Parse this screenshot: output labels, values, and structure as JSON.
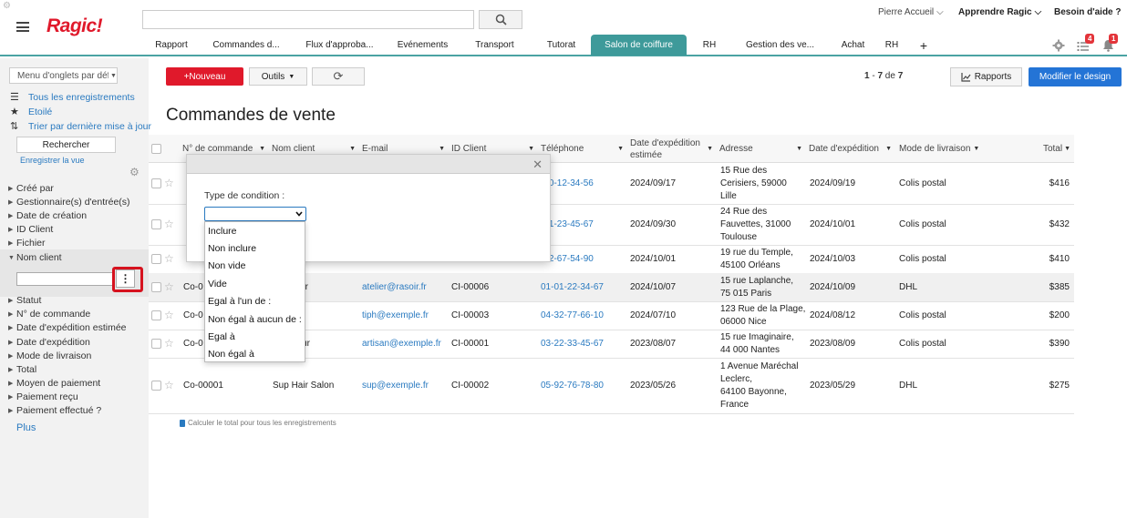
{
  "app": {
    "logo": "Ragic!",
    "search_placeholder": ""
  },
  "top_links": {
    "user": "Pierre Accueil",
    "learn": "Apprendre Ragic",
    "help": "Besoin d'aide ?"
  },
  "tabs": [
    "Rapport",
    "Commandes d...",
    "Flux d'approba...",
    "Evénements",
    "Transport",
    "Tutorat",
    "Salon de coiffure",
    "RH",
    "Gestion des ve...",
    "Achat",
    "RH",
    "+"
  ],
  "badges": {
    "tasks": "4",
    "notifications": "1"
  },
  "sidebar": {
    "tab_menu": "Menu d'onglets par défaut",
    "links": [
      "Tous les enregistrements",
      "Etoilé",
      "Trier par dernière mise à jour"
    ],
    "search_button": "Rechercher",
    "save_view": "Enregistrer la vue",
    "facets_top": [
      "Créé par",
      "Gestionnaire(s) d'entrée(s)",
      "Date de création",
      "ID Client",
      "Fichier"
    ],
    "facet_open": "Nom client",
    "facets_bottom": [
      "Statut",
      "N° de commande",
      "Date d'expédition estimée",
      "Date d'expédition",
      "Mode de livraison",
      "Total",
      "Moyen de paiement",
      "Paiement reçu",
      "Paiement effectué ?"
    ],
    "more": "Plus"
  },
  "toolbar": {
    "new": "+Nouveau",
    "tools": "Outils",
    "reports": "Rapports",
    "design": "Modifier le design"
  },
  "pager": {
    "start": "1",
    "sep": " - ",
    "end": "7",
    "of": " de ",
    "total": "7"
  },
  "page_title": "Commandes de vente",
  "table": {
    "headers": [
      "N° de commande",
      "Nom client",
      "E-mail",
      "ID Client",
      "Téléphone",
      "Date d'expédition estimée",
      "Adresse",
      "Date d'expédition",
      "Mode de livraison",
      "Total"
    ],
    "rows": [
      {
        "order": "",
        "client": "",
        "email": "",
        "id": "",
        "phone": "-20-12-34-56",
        "est": "2024/09/17",
        "addr": [
          "15 Rue des",
          "Cerisiers, 59000",
          "Lille"
        ],
        "ship": "2024/09/19",
        "mode": "Colis postal",
        "total": "$416"
      },
      {
        "order": "",
        "client": "",
        "email": "",
        "id": "",
        "phone": "-61-23-45-67",
        "est": "2024/09/30",
        "addr": [
          "24 Rue des",
          "Fauvettes, 31000",
          "Toulouse"
        ],
        "ship": "2024/10/01",
        "mode": "Colis postal",
        "total": "$432"
      },
      {
        "order": "",
        "client": "",
        "email": "",
        "id": "",
        "phone": "-22-67-54-90",
        "est": "2024/10/01",
        "addr": [
          "19 rue du Temple,",
          "45100 Orléans"
        ],
        "ship": "2024/10/03",
        "mode": "Colis postal",
        "total": "$410"
      },
      {
        "order": "Co-0",
        "client": "du rasoir",
        "email": "atelier@rasoir.fr",
        "id": "CI-00006",
        "phone": "01-01-22-34-67",
        "est": "2024/10/07",
        "addr": [
          "15 rue Laplanche,",
          "75 015 Paris"
        ],
        "ship": "2024/10/09",
        "mode": "DHL",
        "total": "$385"
      },
      {
        "order": "Co-0",
        "client": "ph",
        "email": "tiph@exemple.fr",
        "id": "CI-00003",
        "phone": "04-32-77-66-10",
        "est": "2024/07/10",
        "addr": [
          "123 Rue de la Plage,",
          "06000 Nice"
        ],
        "ship": "2024/08/12",
        "mode": "Colis postal",
        "total": "$200"
      },
      {
        "order": "Co-0",
        "client": "n coiffeur",
        "email": "artisan@exemple.fr",
        "id": "CI-00001",
        "phone": "03-22-33-45-67",
        "est": "2023/08/07",
        "addr": [
          "15 rue Imaginaire,",
          "44 000 Nantes"
        ],
        "ship": "2023/08/09",
        "mode": "Colis postal",
        "total": "$390"
      },
      {
        "order": "Co-00001",
        "client": "Sup Hair Salon",
        "email": "sup@exemple.fr",
        "id": "CI-00002",
        "phone": "05-92-76-78-80",
        "est": "2023/05/26",
        "addr": [
          "1 Avenue Maréchal",
          "Leclerc,",
          "64100 Bayonne,",
          "France"
        ],
        "ship": "2023/05/29",
        "mode": "DHL",
        "total": "$275"
      }
    ],
    "footer": "Calculer le total pour tous les enregistrements"
  },
  "modal": {
    "label": "Type de condition :",
    "options": [
      "Inclure",
      "Non inclure",
      "Non vide",
      "Vide",
      "Egal à l'un de :",
      "Non égal à aucun de :",
      "Egal à",
      "Non égal à"
    ]
  }
}
